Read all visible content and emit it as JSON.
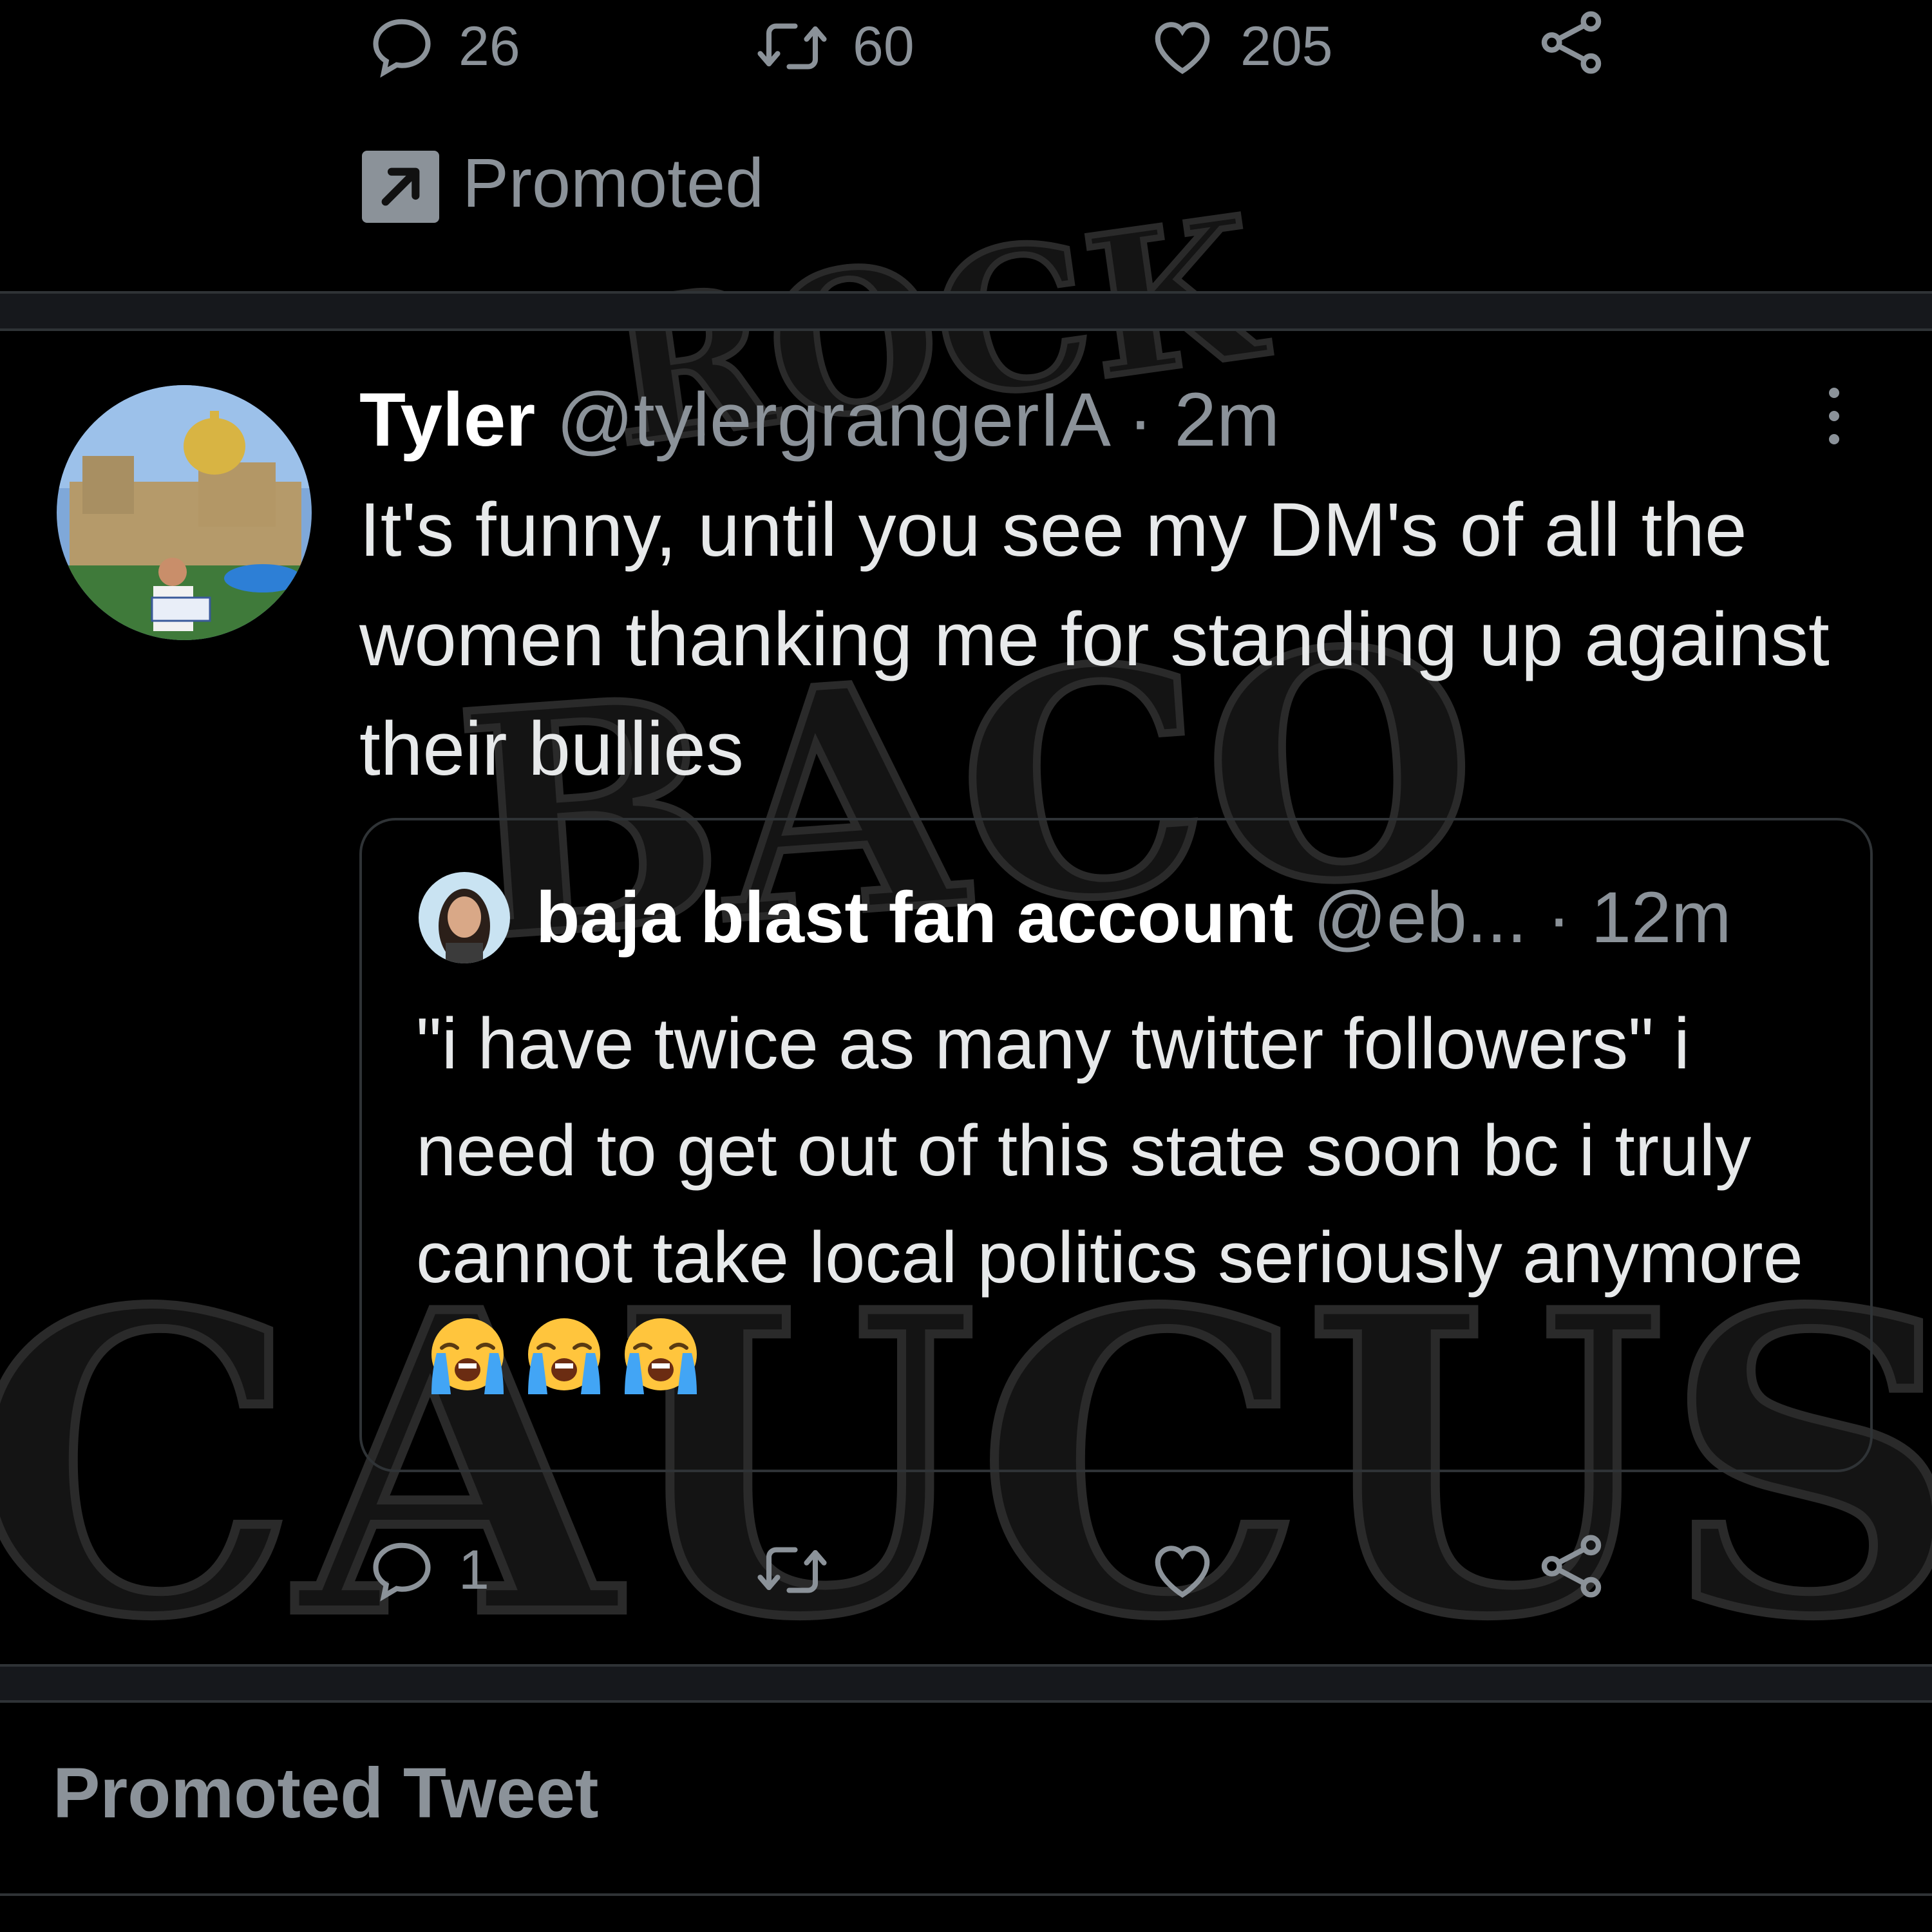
{
  "top_actions": {
    "reply_count": "26",
    "retweet_count": "60",
    "like_count": "205"
  },
  "promoted": {
    "label": "Promoted"
  },
  "tweet": {
    "author_name": "Tyler",
    "handle": "@tylergrangerIA",
    "separator": "·",
    "time": "2m",
    "text": "It's funny, until you see my DM's of all the women thanking me for standing up against their bullies",
    "quoted": {
      "author_name": "baja blast fan account",
      "handle": "@eb...",
      "separator": "·",
      "time": "12m",
      "text": "\"i have twice as many twitter followers\" i need to get out of this state soon bc i truly cannot take local politics seriously anymore",
      "emoji": [
        "😭",
        "😭",
        "😭"
      ]
    },
    "actions": {
      "reply_count": "1",
      "retweet_count": "",
      "like_count": ""
    }
  },
  "footer": {
    "promoted_tweet_label": "Promoted Tweet"
  },
  "watermark": {
    "text": "ROCK BACO CAUCUS"
  },
  "colors": {
    "background": "#000000",
    "text_primary": "#e7e9ea",
    "text_secondary": "#8b9299",
    "border": "#2f3336",
    "separator_band": "#16181c",
    "emoji_face": "#ffc53d",
    "emoji_tears": "#42a5f5"
  },
  "icons": {
    "reply": "reply-icon",
    "retweet": "retweet-icon",
    "like": "heart-icon",
    "share": "share-icon",
    "promoted": "promoted-arrow-icon",
    "more": "more-options-icon"
  }
}
